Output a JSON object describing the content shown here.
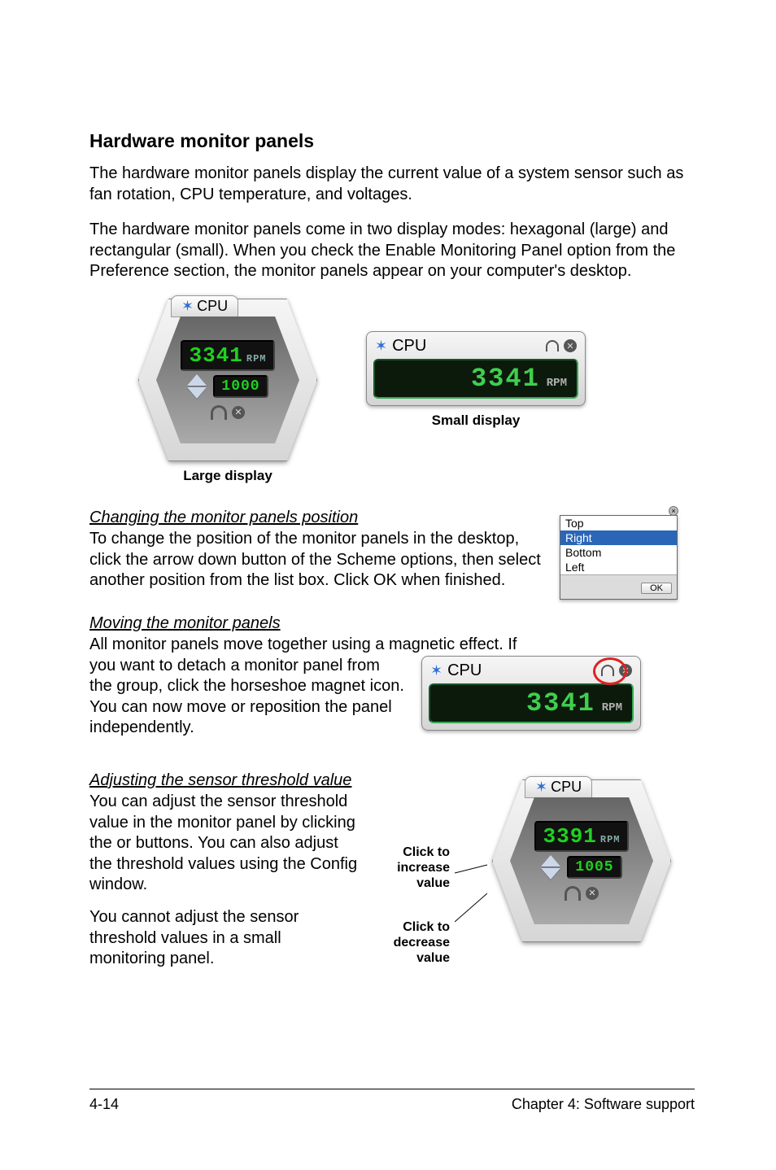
{
  "title": "Hardware monitor panels",
  "p1": "The hardware monitor panels display the current value of a system sensor such as fan rotation, CPU temperature, and voltages.",
  "p2": "The hardware monitor panels come in two display modes: hexagonal (large) and rectangular (small). When you check the Enable Monitoring Panel option from the Preference section, the monitor panels appear on your computer's desktop.",
  "large_caption": "Large display",
  "small_caption": "Small display",
  "sensor": {
    "name": "CPU",
    "value": "3341",
    "unit": "RPM",
    "threshold": "1000"
  },
  "small_panel": {
    "name": "CPU",
    "value": "3341",
    "unit": "RPM"
  },
  "sec_changing": {
    "heading": "Changing the monitor panels position",
    "body": "To change the position of the monitor panels in the desktop, click the arrow down button of the Scheme options, then select another position from the list box. Click OK when finished."
  },
  "position_list": {
    "items": [
      "Top",
      "Right",
      "Bottom",
      "Left"
    ],
    "selected_index": 1,
    "ok_label": "OK"
  },
  "sec_moving": {
    "heading": "Moving the monitor panels",
    "lead": "All monitor panels move together using a magnetic effect. If",
    "body": "you want to detach a monitor panel from the group, click the horseshoe magnet icon. You can now move or reposition the panel independently."
  },
  "detach_panel": {
    "name": "CPU",
    "value": "3341",
    "unit": "RPM"
  },
  "sec_adjust": {
    "heading": "Adjusting the sensor threshold value",
    "body": "You can adjust the sensor threshold value in the monitor panel by clicking the  or  buttons. You can also adjust the threshold values using the Config window.",
    "body2": "You cannot adjust the sensor threshold values in a small monitoring panel."
  },
  "adjust_panel": {
    "name": "CPU",
    "value": "3391",
    "unit": "RPM",
    "threshold": "1005"
  },
  "callouts": {
    "increase": "Click to increase value",
    "decrease": "Click to decrease value"
  },
  "footer": {
    "left": "4-14",
    "right": "Chapter 4: Software support"
  }
}
